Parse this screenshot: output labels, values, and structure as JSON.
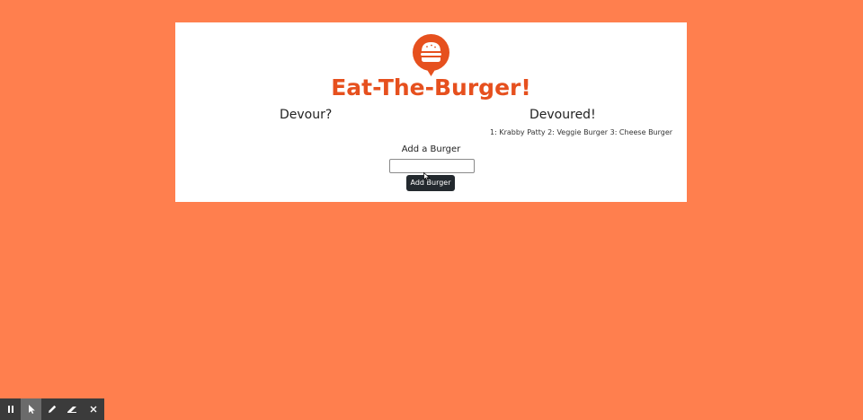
{
  "app": {
    "title": "Eat-The-Burger!",
    "logo_icon": "burger-chat-bubble-icon",
    "accent_color": "#e6501e",
    "background_color": "#ff7f4e"
  },
  "devour": {
    "heading": "Devour?"
  },
  "devoured": {
    "heading": "Devoured!",
    "list_text": "1: Krabby Patty 2: Veggie Burger 3: Cheese Burger"
  },
  "add_form": {
    "label": "Add a Burger",
    "input_value": "",
    "button_label": "Add Burger"
  },
  "toolbar": {
    "tools": [
      {
        "icon": "pause-icon"
      },
      {
        "icon": "pointer-icon"
      },
      {
        "icon": "pen-icon"
      },
      {
        "icon": "eraser-icon"
      },
      {
        "icon": "close-icon"
      }
    ]
  }
}
